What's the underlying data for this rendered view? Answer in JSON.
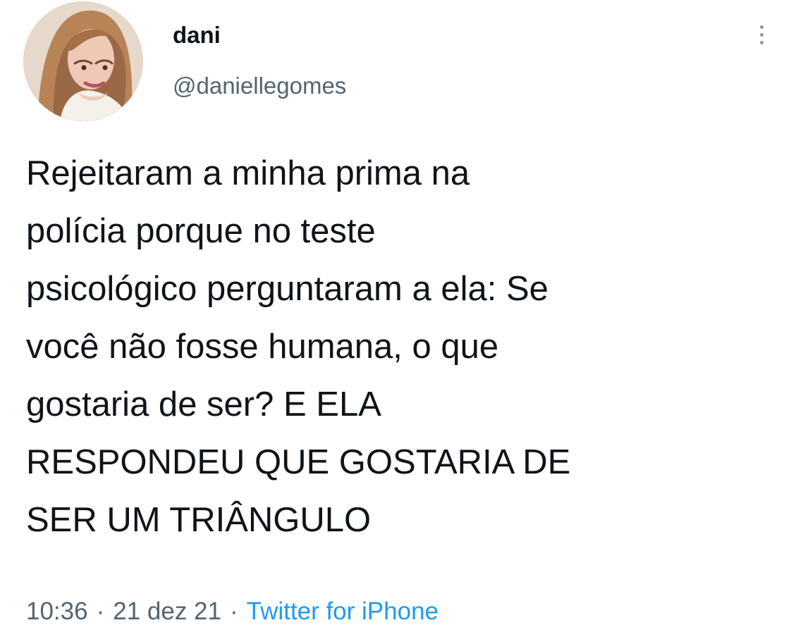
{
  "tweet": {
    "display_name": "dani",
    "handle": "@daniellegomes",
    "avatar_icon": "profile-photo",
    "more_icon": "vertical-ellipsis-icon",
    "text_lines": [
      "Rejeitaram a minha prima na",
      "polícia porque no teste",
      "psicológico perguntaram a ela: Se",
      "você não fosse humana, o que",
      "gostaria de ser? E ELA",
      "RESPONDEU QUE GOSTARIA DE",
      "SER UM TRIÂNGULO"
    ],
    "time": "10:36",
    "separator_1": "·",
    "date": "21 dez 21",
    "separator_2": "·",
    "source": "Twitter for iPhone"
  },
  "colors": {
    "text": "#0f1419",
    "secondary_text": "#536471",
    "link": "#1d9bf0",
    "more_dots": "#8b98a5",
    "background": "#ffffff"
  }
}
